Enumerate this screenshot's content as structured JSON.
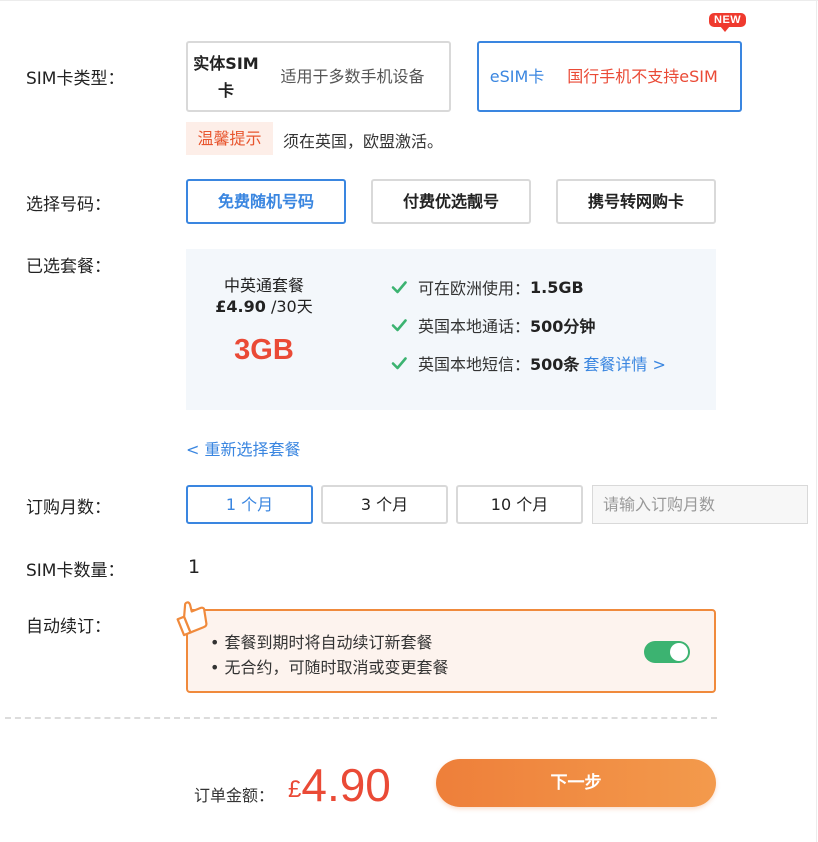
{
  "sim_type": {
    "label": "SIM卡类型：",
    "options": [
      {
        "title": "实体SIM卡",
        "desc": "适用于多数手机设备",
        "selected": false
      },
      {
        "title": "eSIM卡",
        "desc": "国行手机不支持eSIM",
        "selected": true,
        "badge": "NEW"
      }
    ],
    "tip_tag": "温馨提示",
    "tip_text": "须在英国，欧盟激活。"
  },
  "number": {
    "label": "选择号码：",
    "options": [
      "免费随机号码",
      "付费优选靓号",
      "携号转网购卡"
    ],
    "selected_index": 0
  },
  "plan": {
    "label": "已选套餐：",
    "name": "中英通套餐",
    "price": "£4.90",
    "period": "/30天",
    "data": "3GB",
    "features": [
      {
        "text": "可在欧洲使用：",
        "value": "1.5GB"
      },
      {
        "text": "英国本地通话：",
        "value": "500分钟"
      },
      {
        "text": "英国本地短信：",
        "value": "500条",
        "link": "套餐详情 >"
      }
    ],
    "reselect": "< 重新选择套餐"
  },
  "months": {
    "label": "订购月数：",
    "options": [
      "1 个月",
      "3 个月",
      "10 个月"
    ],
    "selected_index": 0,
    "input_placeholder": "请输入订购月数"
  },
  "quantity": {
    "label": "SIM卡数量：",
    "value": "1"
  },
  "auto_renew": {
    "label": "自动续订：",
    "lines": [
      "• 套餐到期时将自动续订新套餐",
      "• 无合约，可随时取消或变更套餐"
    ],
    "enabled": true
  },
  "order": {
    "total_label": "订单金额：",
    "currency": "£",
    "amount": "4.90",
    "next_button": "下一步"
  },
  "colors": {
    "accent": "#3a86e0",
    "price": "#ea4a36",
    "orange": "#f08a3c",
    "toggle_on": "#3cb371"
  }
}
